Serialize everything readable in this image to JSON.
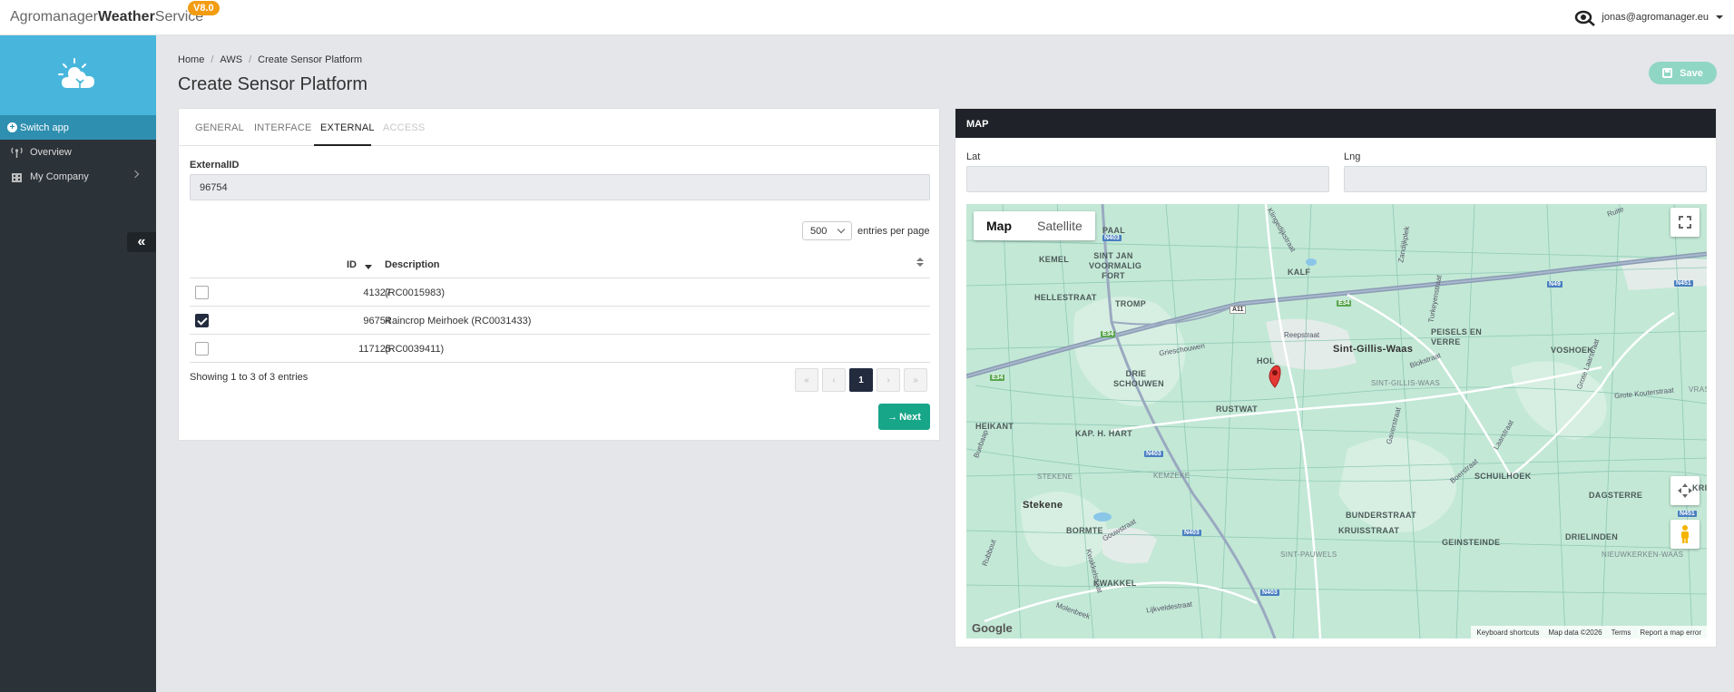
{
  "app": {
    "brand_light": "Agromanager",
    "brand_bold": "Weather",
    "brand_light2": "Service",
    "version": "V8.0",
    "user_email": "jonas@agromanager.eu"
  },
  "sidebar": {
    "switch_app": "Switch app",
    "items": [
      {
        "label": "Overview",
        "icon": "antenna-icon"
      },
      {
        "label": "My Company",
        "icon": "building-icon"
      }
    ],
    "collapse_symbol": "«"
  },
  "breadcrumb": [
    "Home",
    "AWS",
    "Create Sensor Platform"
  ],
  "page_title": "Create Sensor Platform",
  "save_label": "Save",
  "tabs": [
    {
      "label": "GENERAL",
      "state": "normal"
    },
    {
      "label": "INTERFACE",
      "state": "normal"
    },
    {
      "label": "EXTERNAL",
      "state": "active"
    },
    {
      "label": "ACCESS",
      "state": "disabled"
    }
  ],
  "external_form": {
    "label": "ExternalID",
    "value": "96754"
  },
  "table": {
    "page_size": "500",
    "entries_text": "entries per page",
    "columns": [
      "ID",
      "Description"
    ],
    "rows": [
      {
        "id": "41327",
        "description": "(RC0015983)",
        "checked": false
      },
      {
        "id": "96754",
        "description": "Raincrop Meirhoek (RC0031433)",
        "checked": true
      },
      {
        "id": "117125",
        "description": "(RC0039411)",
        "checked": false
      }
    ],
    "info": "Showing 1 to 3 of 3 entries",
    "pager": [
      "«",
      "‹",
      "1",
      "›",
      "»"
    ]
  },
  "next_label": "Next",
  "map_panel": {
    "title": "MAP",
    "lat_label": "Lat",
    "lng_label": "Lng",
    "map_type": [
      "Map",
      "Satellite"
    ],
    "places": [
      "PAAL",
      "KEMEL",
      "SINT JAN VOORMALIG FORT",
      "HELLESTRAAT",
      "TROMP",
      "KALF",
      "PEISELS EN VERRE",
      "Sint-Gillis-Waas",
      "VOSHOEK",
      "DRIE SCHOUWEN",
      "HOL",
      "SINT-GILLIS-WAAS",
      "RUSTWAT",
      "HEIKANT",
      "KAP. H. HART",
      "STEKENE",
      "KEMZEKE",
      "Stekene",
      "BORMTE",
      "KRUISSTRAAT",
      "BUNDERSTRAAT",
      "GEINSTEINDE",
      "DRIELINDEN",
      "SCHUILHOEK",
      "DAGSTERRE",
      "KWAKKEL",
      "SINT-PAUWELS",
      "NIEUWKERKEN-WAAS",
      "KRIE",
      "VRASE"
    ],
    "streets": [
      "Klingedijkstraat",
      "Zandijkplek",
      "Turkeyenstraat",
      "Reepstraat",
      "Grieschouwen",
      "Blokstraat",
      "Grote Kouterstraat",
      "Grote Laarstraat",
      "Gaverstraat",
      "Laarstraat",
      "Boerstraat",
      "Gouwstraat",
      "Kwakkelstraat",
      "Molenbeek",
      "Lijkveldestraat",
      "Rubbout",
      "Buebaap",
      "Ruite"
    ],
    "road_labels": [
      "N403",
      "A11",
      "E34",
      "N49",
      "N451",
      "N403",
      "N403",
      "N403",
      "N451",
      "E34",
      "E34"
    ],
    "google": "Google",
    "attribution": [
      "Keyboard shortcuts",
      "Map data ©2026",
      "Terms",
      "Report a map error"
    ]
  },
  "colors": {
    "sidebar_bg": "#2b3238",
    "sidebar_head": "#48b6dc",
    "accent_green": "#18a689",
    "save_disabled": "#8fd6c4",
    "version_badge": "#f39c12",
    "map_header": "#1f2329",
    "pin": "#e53935"
  }
}
